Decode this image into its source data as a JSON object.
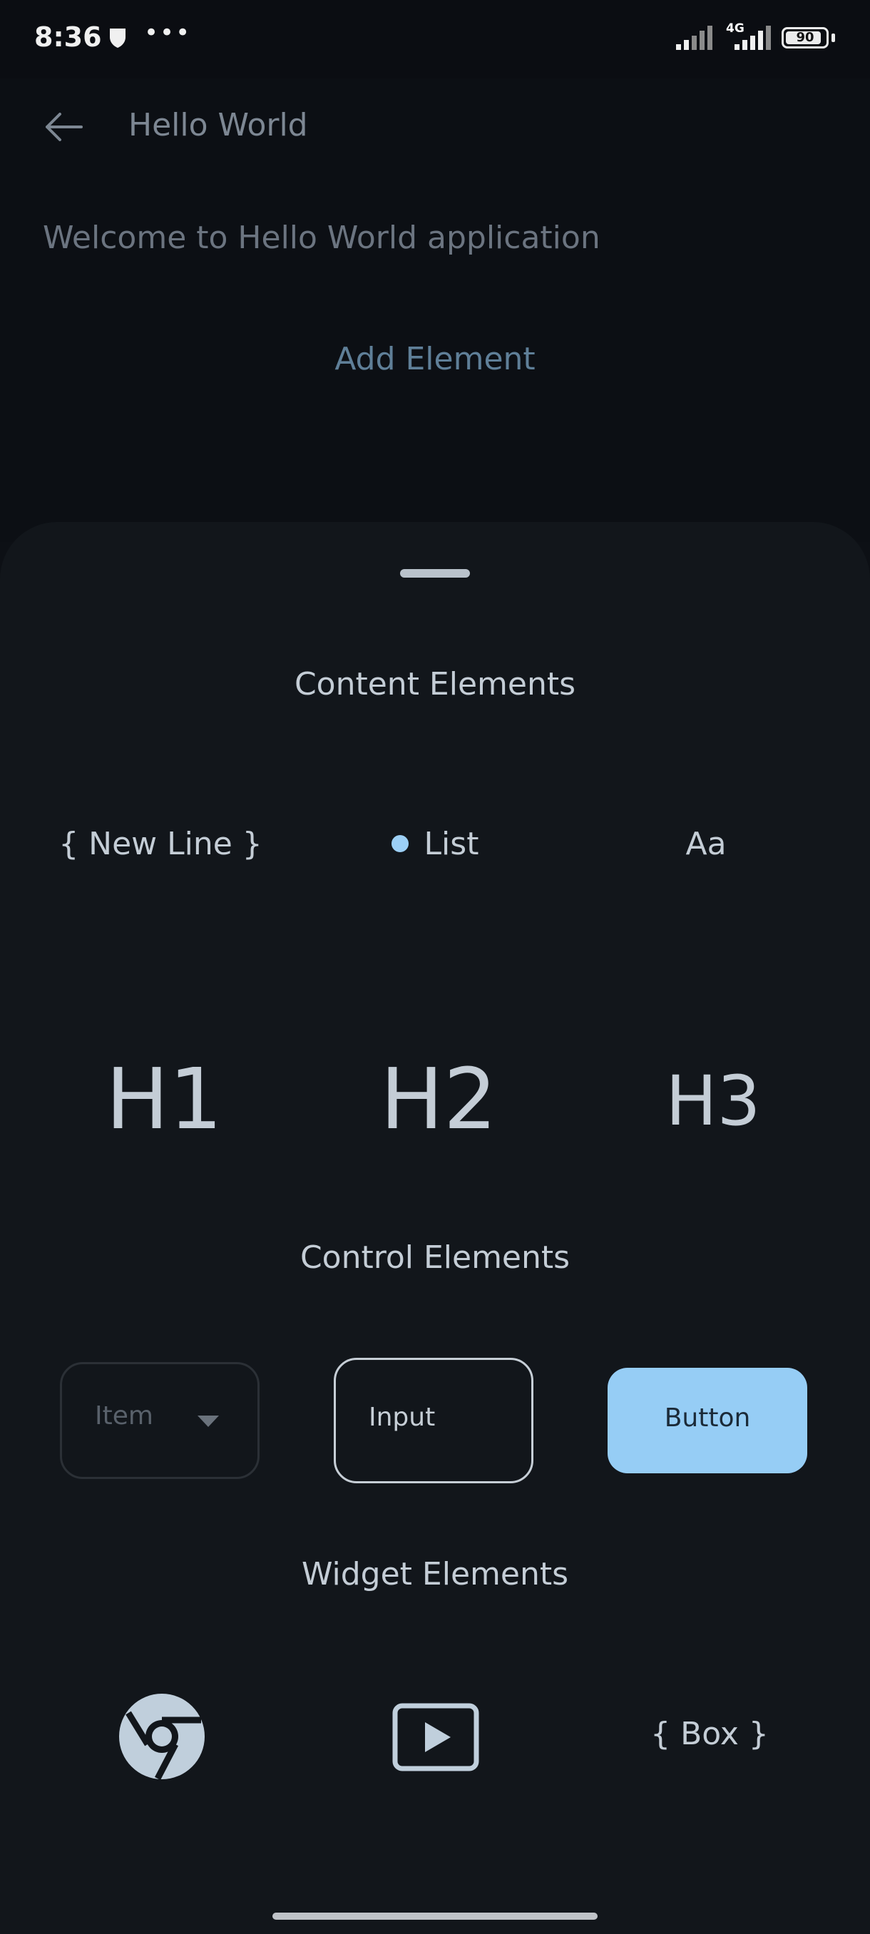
{
  "status_bar": {
    "time": "8:36",
    "network": "4G",
    "battery": "90",
    "battery_level": 0.9,
    "icons": [
      "shield-icon",
      "more-dots-icon",
      "signal-icon",
      "signal-4g-icon",
      "battery-icon"
    ]
  },
  "app": {
    "title": "Hello World",
    "welcome_text": "Welcome to Hello World application",
    "add_element_label": "Add Element"
  },
  "sheet": {
    "content_section_title": "Content Elements",
    "content_items": {
      "new_line": "{ New Line }",
      "list": "List",
      "text": "Aa",
      "h1": "H1",
      "h2": "H2",
      "h3": "H3"
    },
    "control_section_title": "Control Elements",
    "control_items": {
      "dropdown_label": "Item",
      "input_label": "Input",
      "button_label": "Button"
    },
    "widget_section_title": "Widget Elements",
    "widget_items": {
      "web_icon": "chrome-icon",
      "video_icon": "video-play-icon",
      "box_label": "{ Box }"
    }
  },
  "colors": {
    "accent": "#96cdf5",
    "sheet_background": "#12161b",
    "text_primary": "#c4cdd6"
  }
}
